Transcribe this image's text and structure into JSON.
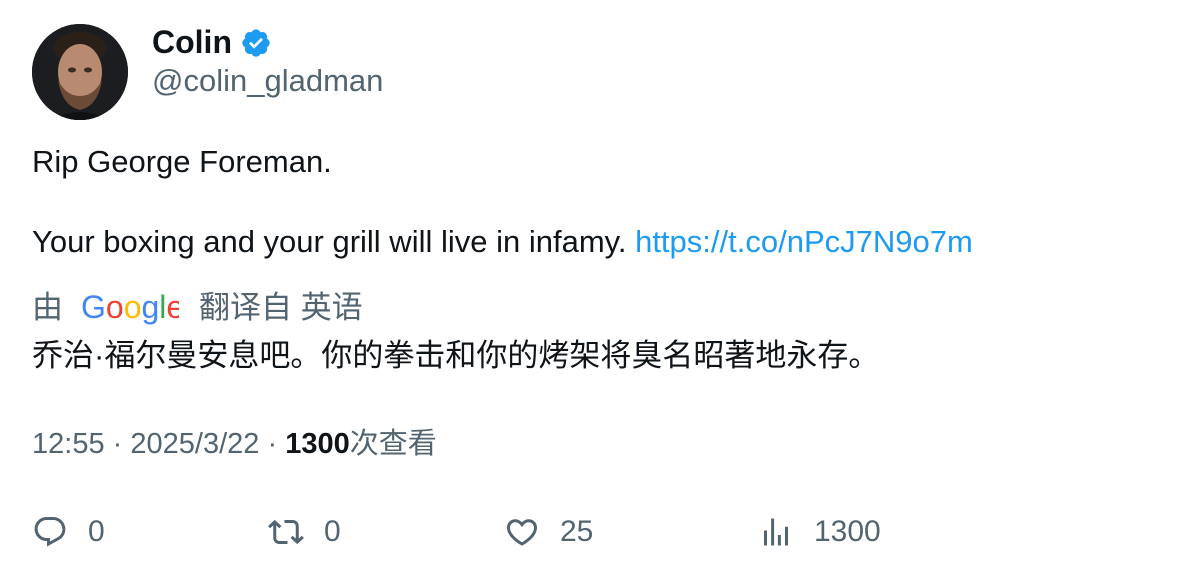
{
  "author": {
    "display_name": "Colin",
    "handle": "@colin_gladman",
    "verified_icon": "verified-badge-icon"
  },
  "tweet": {
    "line1": "Rip George Foreman.",
    "line2": "Your boxing and your grill will live in infamy.",
    "link": "https://t.co/nPcJ7N9o7m"
  },
  "translation": {
    "prefix": "由",
    "brand": "Google",
    "suffix": "翻译自 英语",
    "text": "乔治·福尔曼安息吧。你的拳击和你的烤架将臭名昭著地永存。"
  },
  "meta": {
    "time": "12:55",
    "separator": "·",
    "date": "2025/3/22",
    "views_count": "1300",
    "views_label": "次查看"
  },
  "actions": {
    "reply_count": "0",
    "retweet_count": "0",
    "like_count": "25",
    "views_count": "1300"
  },
  "colors": {
    "link": "#1d9bf0",
    "muted": "#536471",
    "text": "#0f1419",
    "verified": "#1d9bf0"
  }
}
